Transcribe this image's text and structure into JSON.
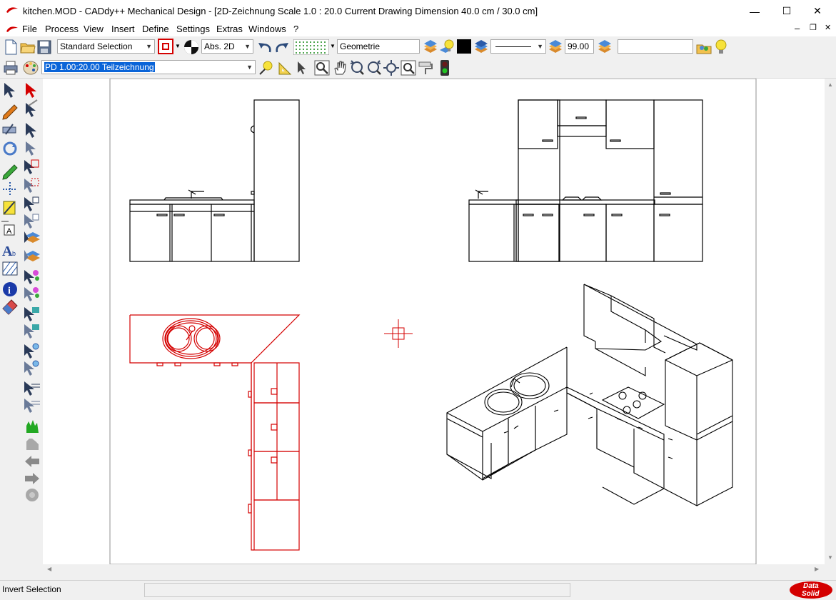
{
  "window": {
    "title": "kitchen.MOD  -  CADdy++ Mechanical Design - [2D-Zeichnung   Scale 1.0 : 20.0   Current Drawing Dimension 40.0 cm / 30.0 cm]",
    "minimize_glyph": "—",
    "maximize_glyph": "☐",
    "close_glyph": "✕"
  },
  "menu": {
    "items": [
      "File",
      "Process",
      "View",
      "Insert",
      "Define",
      "Settings",
      "Extras",
      "Windows",
      "?"
    ],
    "mdi_minimize": "–",
    "mdi_restore": "❐",
    "mdi_close": "✕"
  },
  "toolbar1": {
    "selection_mode": "Standard Selection",
    "coord_mode": "Abs. 2D",
    "layer_name": "Geometrie",
    "line_width_value": "99.00",
    "extra_field": ""
  },
  "toolbar2": {
    "view_name": "PD 1.00:20.00 Teilzeichnung"
  },
  "status": {
    "message": "Invert Selection",
    "field2": "",
    "brand_line1": "Data",
    "brand_line2": "Solid"
  },
  "colors": {
    "selected_red": "#d40000",
    "selection_blue": "#0a64d8",
    "drawing_black": "#000000"
  },
  "palette_icons": [
    "select-arrow-icon",
    "red-arrow-icon",
    "pencil-icon",
    "move-arrows-icon",
    "wrench-icon",
    "arrow-cut-icon",
    "rotate-icon",
    "arrow-tool-icon",
    "green-pencil-icon",
    "arrow-red-box-icon",
    "dotted-line-icon",
    "arrow-dashed-icon",
    "yellow-measure-icon",
    "arrow-pick-icon",
    "text-frame-icon",
    "arrow-pick2-icon",
    "text-a-icon",
    "arrow-layer-icon",
    "hatch-icon",
    "arrow-color-icon",
    "info-icon",
    "arrow-color2-icon",
    "eraser-icon",
    "arrow-layer2-icon"
  ]
}
